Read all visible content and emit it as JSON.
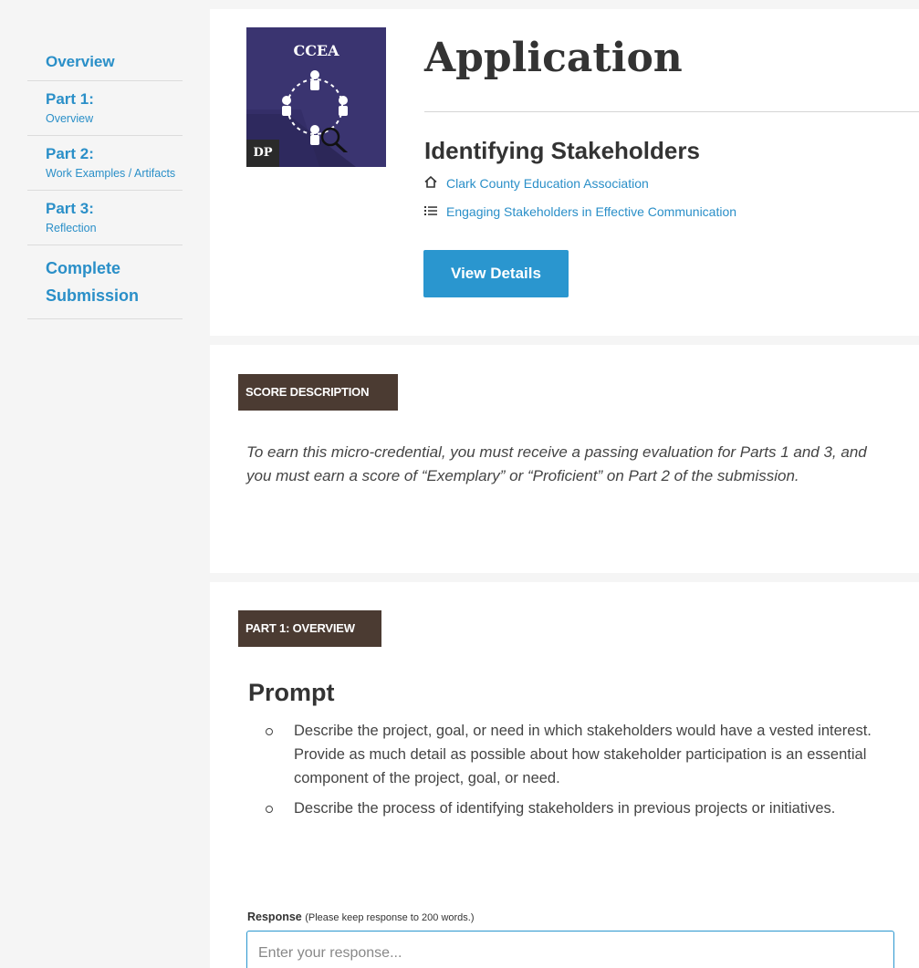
{
  "sidebar": {
    "items": [
      {
        "label": "Overview",
        "sub": ""
      },
      {
        "label": "Part 1:",
        "sub": "Overview"
      },
      {
        "label": "Part 2:",
        "sub": "Work Examples / Artifacts"
      },
      {
        "label": "Part 3:",
        "sub": "Reflection"
      },
      {
        "label": "Complete Submission",
        "sub": ""
      }
    ]
  },
  "header": {
    "badge_org": "CCEA",
    "badge_code": "DP",
    "title": "Application",
    "subtitle": "Identifying Stakeholders",
    "org_link": "Clark County Education Association",
    "stack_link": "Engaging Stakeholders in Effective Communication",
    "view_details": "View Details",
    "icons": {
      "org": "home-icon",
      "stack": "list-icon"
    },
    "badge_color": "#3a3470"
  },
  "score": {
    "tag": "SCORE DESCRIPTION",
    "text": "To earn this micro-credential, you must receive a passing evaluation for Parts 1 and 3, and you must earn a score of “Exemplary” or “Proficient” on Part 2 of the submission."
  },
  "part1": {
    "tag": "PART 1: OVERVIEW",
    "prompt_heading": "Prompt",
    "prompts": [
      "Describe the project, goal, or need in which stakeholders would have a vested interest. Provide as much detail as possible about how stakeholder participation is an essential component of the project, goal, or need.",
      "Describe the process of identifying stakeholders in previous projects or initiatives."
    ],
    "response_label": "Response",
    "response_note": "(Please keep response to 200 words.)",
    "response_placeholder": "Enter your response...",
    "response_value": ""
  },
  "colors": {
    "accent": "#2a96cf",
    "tag_bg": "#4b3b32"
  }
}
